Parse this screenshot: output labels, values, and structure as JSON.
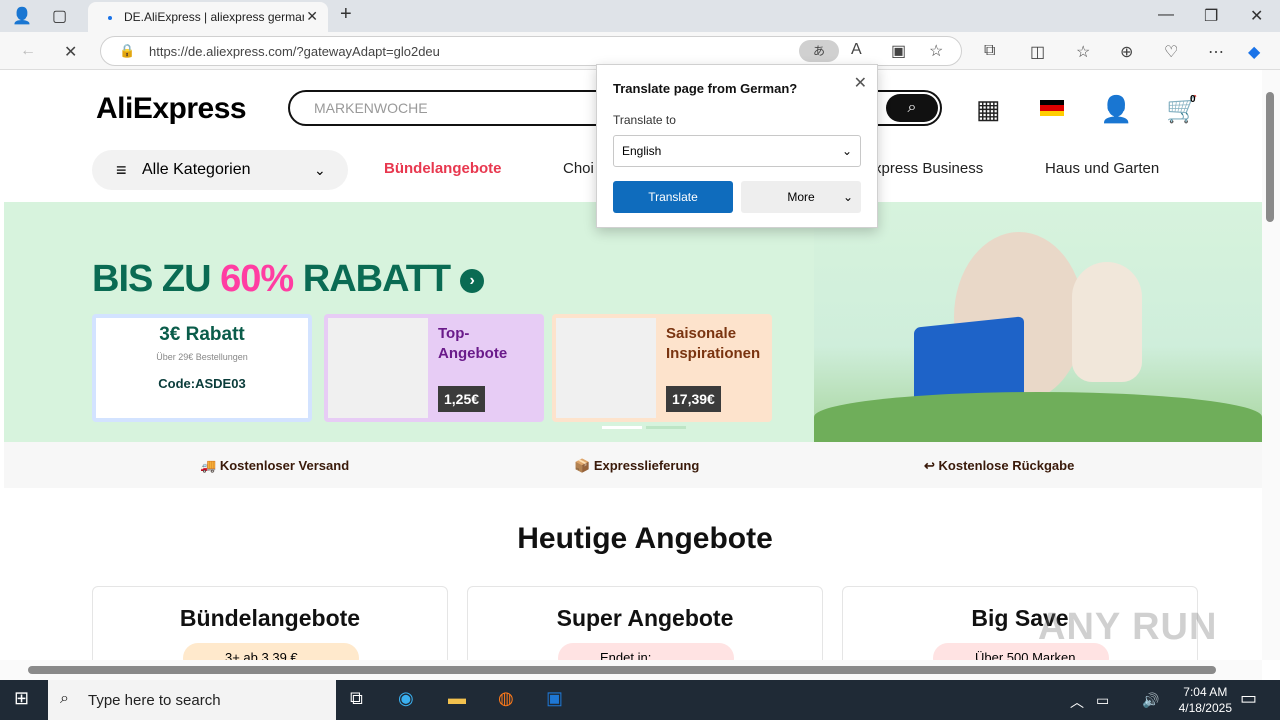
{
  "browser": {
    "tab_title": "DE.AliExpress | aliexpress german",
    "url": "https://de.aliexpress.com/?gatewayAdapt=glo2deu",
    "new_tab": "+"
  },
  "header": {
    "logo": "AliExpress",
    "search_placeholder": "MARKENWOCHE",
    "categories_label": "Alle Kategorien",
    "nav": [
      "Bündelangebote",
      "Choi",
      "xpress Business",
      "Haus und Garten"
    ],
    "cart_count": "0"
  },
  "banner": {
    "headline_a": "BIS ZU ",
    "headline_pct": "60%",
    "headline_b": " RABATT",
    "coupon": {
      "amount": "3€ Rabatt",
      "min": "Über 29€ Bestellungen",
      "code": "Code:ASDE03"
    },
    "products": [
      {
        "label": "Top-Angebote",
        "price": "1,25€"
      },
      {
        "label": "Saisonale Inspirationen",
        "price": "17,39€"
      }
    ]
  },
  "features": [
    "Kostenloser Versand",
    "Expresslieferung",
    "Kostenlose Rückgabe"
  ],
  "section_title": "Heutige Angebote",
  "deal_cards": [
    {
      "title": "Bündelangebote",
      "pill": "3+ ab 3,39 €"
    },
    {
      "title": "Super Angebote",
      "pill": "Endet in:"
    },
    {
      "title": "Big Save",
      "pill": "Über 500 Marken"
    }
  ],
  "translate_popup": {
    "question": "Translate page from German?",
    "to_label": "Translate to",
    "selected": "English",
    "translate_button": "Translate",
    "more_button": "More"
  },
  "taskbar": {
    "search_placeholder": "Type here to search",
    "time": "7:04 AM",
    "date": "4/18/2025"
  },
  "watermark": "ANY RUN",
  "colors": {
    "accent": "#0f6cbd",
    "banner_bg": "#d7f3dd",
    "headline": "#0a6b53",
    "pink": "#ff3da2",
    "nav_red": "#e8384f"
  }
}
